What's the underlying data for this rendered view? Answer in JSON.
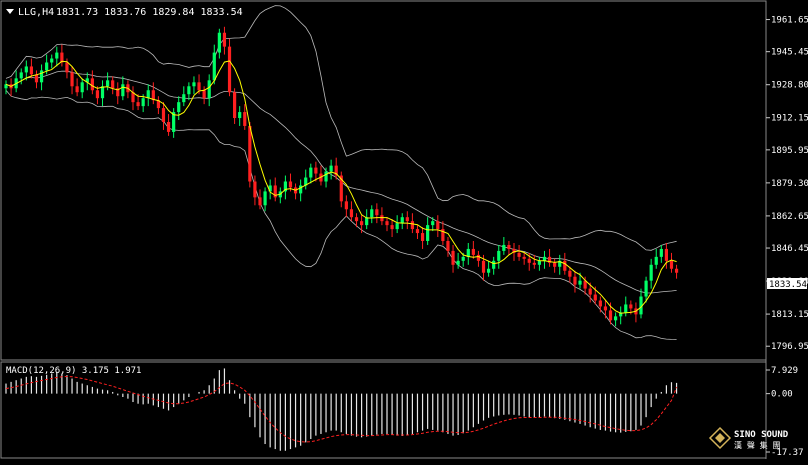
{
  "header": {
    "symbol_label": "LLG,H4",
    "ohlc": "1831.73 1833.76 1829.84 1833.54"
  },
  "price_axis": {
    "ticks": [
      "1961.65",
      "1945.45",
      "1928.80",
      "1912.15",
      "1895.95",
      "1879.30",
      "1862.65",
      "1846.45",
      "1829.80",
      "1813.15",
      "1796.95"
    ],
    "current_price": "1833.54"
  },
  "macd": {
    "label": "MACD(12,26,9) 3.175 1.971",
    "ticks": [
      "7.929",
      "0.00",
      "-17.37"
    ]
  },
  "logo": {
    "brand": "SINO SOUND",
    "sub": "漢 聲 集 團"
  },
  "colors": {
    "up": "#00ff66",
    "down": "#ff2020",
    "ma": "#ffff00",
    "bands": "#bbbbbb",
    "signal": "#ff2020"
  },
  "chart_data": {
    "type": "candlestick",
    "price_ylim": [
      1790,
      1971
    ],
    "macd_ylim": [
      -17.37,
      7.929
    ],
    "close": [
      1929,
      1927,
      1932,
      1935,
      1938,
      1934,
      1930,
      1936,
      1940,
      1942,
      1945,
      1940,
      1935,
      1928,
      1925,
      1930,
      1932,
      1926,
      1922,
      1928,
      1931,
      1927,
      1923,
      1929,
      1925,
      1920,
      1918,
      1922,
      1926,
      1921,
      1917,
      1910,
      1905,
      1915,
      1920,
      1924,
      1928,
      1930,
      1926,
      1922,
      1931,
      1945,
      1955,
      1948,
      1925,
      1912,
      1915,
      1908,
      1880,
      1872,
      1868,
      1875,
      1878,
      1872,
      1875,
      1880,
      1877,
      1874,
      1878,
      1882,
      1887,
      1884,
      1880,
      1885,
      1888,
      1883,
      1870,
      1866,
      1862,
      1860,
      1858,
      1862,
      1866,
      1863,
      1860,
      1858,
      1856,
      1859,
      1862,
      1860,
      1856,
      1854,
      1850,
      1858,
      1860,
      1856,
      1850,
      1845,
      1838,
      1840,
      1842,
      1846,
      1843,
      1840,
      1834,
      1836,
      1840,
      1845,
      1848,
      1846,
      1844,
      1842,
      1841,
      1839,
      1838,
      1840,
      1842,
      1839,
      1837,
      1840,
      1835,
      1832,
      1828,
      1830,
      1826,
      1823,
      1820,
      1817,
      1815,
      1810,
      1812,
      1814,
      1818,
      1816,
      1813,
      1822,
      1830,
      1838,
      1842,
      1846,
      1840,
      1836,
      1834
    ],
    "macd_hist": [
      3.0,
      3.5,
      4.0,
      4.5,
      5.0,
      5.2,
      5.0,
      5.3,
      5.6,
      6.0,
      6.5,
      6.0,
      5.5,
      4.5,
      3.5,
      3.0,
      2.5,
      2.0,
      1.5,
      1.2,
      1.0,
      0.5,
      -0.5,
      -1.0,
      -1.5,
      -2.5,
      -3.0,
      -3.2,
      -3.0,
      -3.5,
      -4.0,
      -4.5,
      -5.0,
      -4.0,
      -3.0,
      -2.0,
      -1.0,
      0.0,
      0.5,
      1.0,
      2.5,
      4.5,
      7.0,
      7.5,
      4.0,
      1.0,
      -1.5,
      -3.0,
      -7.0,
      -10.0,
      -13.0,
      -15.0,
      -16.0,
      -16.5,
      -17.0,
      -17.0,
      -16.5,
      -16.0,
      -15.5,
      -14.5,
      -13.5,
      -12.5,
      -12.0,
      -11.5,
      -11.0,
      -11.0,
      -11.5,
      -12.0,
      -12.5,
      -12.8,
      -13.0,
      -12.8,
      -12.5,
      -12.2,
      -12.0,
      -12.0,
      -12.3,
      -12.5,
      -12.6,
      -12.4,
      -12.0,
      -11.5,
      -11.0,
      -10.5,
      -10.8,
      -11.0,
      -11.5,
      -12.0,
      -12.5,
      -12.3,
      -11.8,
      -11.0,
      -10.0,
      -9.0,
      -8.0,
      -7.2,
      -6.8,
      -6.5,
      -6.3,
      -6.2,
      -6.3,
      -6.5,
      -6.8,
      -7.0,
      -7.2,
      -7.0,
      -6.8,
      -7.0,
      -7.3,
      -7.5,
      -7.8,
      -8.2,
      -8.6,
      -9.0,
      -9.5,
      -10.0,
      -10.4,
      -10.8,
      -11.0,
      -11.3,
      -11.5,
      -11.6,
      -11.4,
      -11.2,
      -10.8,
      -9.5,
      -7.0,
      -4.0,
      -1.5,
      0.5,
      2.5,
      3.4,
      3.2
    ],
    "macd_signal": [
      1.5,
      1.8,
      2.1,
      2.5,
      2.9,
      3.3,
      3.6,
      3.9,
      4.2,
      4.5,
      4.8,
      5.0,
      5.1,
      5.0,
      4.8,
      4.5,
      4.2,
      3.8,
      3.4,
      3.0,
      2.6,
      2.2,
      1.7,
      1.2,
      0.7,
      0.2,
      -0.3,
      -0.8,
      -1.2,
      -1.6,
      -2.0,
      -2.4,
      -2.8,
      -3.0,
      -3.0,
      -2.8,
      -2.5,
      -2.0,
      -1.5,
      -1.0,
      -0.3,
      0.6,
      1.8,
      3.0,
      3.2,
      2.8,
      2.0,
      1.0,
      -0.6,
      -2.5,
      -4.6,
      -6.7,
      -8.6,
      -10.2,
      -11.6,
      -12.7,
      -13.5,
      -14.0,
      -14.3,
      -14.4,
      -14.3,
      -14.0,
      -13.6,
      -13.2,
      -12.8,
      -12.5,
      -12.3,
      -12.2,
      -12.2,
      -12.3,
      -12.4,
      -12.5,
      -12.5,
      -12.4,
      -12.3,
      -12.2,
      -12.2,
      -12.3,
      -12.3,
      -12.3,
      -12.2,
      -12.0,
      -11.8,
      -11.5,
      -11.3,
      -11.2,
      -11.2,
      -11.3,
      -11.5,
      -11.6,
      -11.6,
      -11.5,
      -11.2,
      -10.8,
      -10.3,
      -9.7,
      -9.1,
      -8.6,
      -8.1,
      -7.7,
      -7.4,
      -7.2,
      -7.1,
      -7.1,
      -7.1,
      -7.1,
      -7.0,
      -7.0,
      -7.0,
      -7.1,
      -7.3,
      -7.5,
      -7.7,
      -8.0,
      -8.3,
      -8.7,
      -9.0,
      -9.4,
      -9.8,
      -10.1,
      -10.4,
      -10.7,
      -10.9,
      -11.0,
      -11.0,
      -10.8,
      -10.2,
      -9.2,
      -7.8,
      -6.0,
      -4.0,
      -2.0,
      1.971
    ]
  }
}
